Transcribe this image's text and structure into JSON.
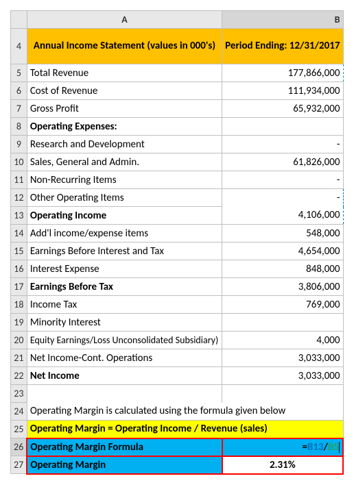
{
  "colHeaders": {
    "A": "A",
    "B": "B"
  },
  "rowHeaders": [
    "4",
    "5",
    "6",
    "7",
    "8",
    "9",
    "10",
    "11",
    "12",
    "13",
    "14",
    "15",
    "16",
    "17",
    "18",
    "19",
    "20",
    "21",
    "22",
    "23",
    "24",
    "25",
    "26",
    "27"
  ],
  "header": {
    "A": "Annual Income Statement (values in 000's)",
    "B": "Period Ending: 12/31/2017"
  },
  "rows": {
    "5": {
      "A": "Total Revenue",
      "B": "177,866,000"
    },
    "6": {
      "A": "Cost of Revenue",
      "B": "111,934,000"
    },
    "7": {
      "A": "Gross Profit",
      "B": "65,932,000"
    },
    "8": {
      "A": "Operating Expenses:",
      "B": ""
    },
    "9": {
      "A": "Research and Development",
      "B": "-"
    },
    "10": {
      "A": "Sales, General and Admin.",
      "B": "61,826,000"
    },
    "11": {
      "A": "Non-Recurring Items",
      "B": "-"
    },
    "12": {
      "A": "Other Operating Items",
      "B": "-"
    },
    "13": {
      "A": "Operating Income",
      "B": "4,106,000"
    },
    "14": {
      "A": "Add'l income/expense items",
      "B": "548,000"
    },
    "15": {
      "A": "Earnings Before Interest and Tax",
      "B": "4,654,000"
    },
    "16": {
      "A": "Interest Expense",
      "B": "848,000"
    },
    "17": {
      "A": "Earnings Before Tax",
      "B": "3,806,000"
    },
    "18": {
      "A": "Income Tax",
      "B": "769,000"
    },
    "19": {
      "A": "Minority Interest",
      "B": ""
    },
    "20": {
      "A": "Equity Earnings/Loss Unconsolidated Subsidiary)",
      "B": "4,000"
    },
    "21": {
      "A": "Net Income-Cont. Operations",
      "B": "3,033,000"
    },
    "22": {
      "A": "Net Income",
      "B": "3,033,000"
    },
    "24": {
      "A": "Operating Margin is calculated using the formula given below",
      "B": ""
    },
    "25": {
      "A": "Operating Margin = Operating Income / Revenue (sales)",
      "B": ""
    },
    "26": {
      "A": "Operating Margin Formula",
      "B_prefix": "=",
      "B_ref1": "B13",
      "B_sep": "/",
      "B_ref2": "B5"
    },
    "27": {
      "A": "Operating Margin",
      "B": "2.31%"
    }
  },
  "chart_data": {
    "type": "table",
    "title": "Annual Income Statement (values in 000's)",
    "period": "Period Ending: 12/31/2017",
    "items": [
      {
        "label": "Total Revenue",
        "value": 177866000
      },
      {
        "label": "Cost of Revenue",
        "value": 111934000
      },
      {
        "label": "Gross Profit",
        "value": 65932000
      },
      {
        "label": "Operating Expenses:",
        "value": null
      },
      {
        "label": "Research and Development",
        "value": null
      },
      {
        "label": "Sales, General and Admin.",
        "value": 61826000
      },
      {
        "label": "Non-Recurring Items",
        "value": null
      },
      {
        "label": "Other Operating Items",
        "value": null
      },
      {
        "label": "Operating Income",
        "value": 4106000
      },
      {
        "label": "Add'l income/expense items",
        "value": 548000
      },
      {
        "label": "Earnings Before Interest and Tax",
        "value": 4654000
      },
      {
        "label": "Interest Expense",
        "value": 848000
      },
      {
        "label": "Earnings Before Tax",
        "value": 3806000
      },
      {
        "label": "Income Tax",
        "value": 769000
      },
      {
        "label": "Minority Interest",
        "value": null
      },
      {
        "label": "Equity Earnings/Loss Unconsolidated Subsidiary)",
        "value": 4000
      },
      {
        "label": "Net Income-Cont. Operations",
        "value": 3033000
      },
      {
        "label": "Net Income",
        "value": 3033000
      }
    ],
    "formula": "Operating Margin = Operating Income / Revenue (sales)",
    "operating_margin_formula": "=B13/B5",
    "operating_margin": "2.31%"
  }
}
